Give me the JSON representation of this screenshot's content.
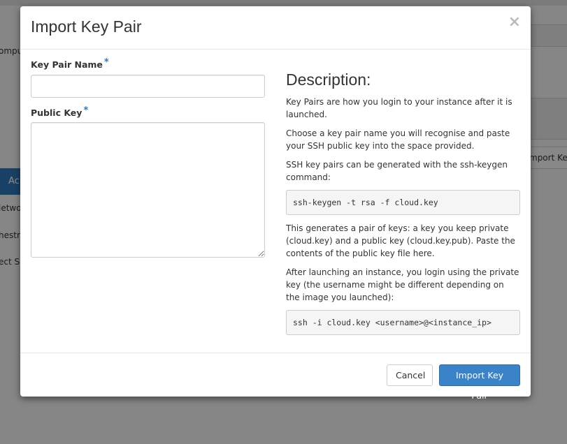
{
  "background": {
    "partial_texts": [
      "ompu",
      "Ac",
      "letwo",
      "hestr",
      "ect S",
      "mport Ke"
    ]
  },
  "modal": {
    "title": "Import Key Pair",
    "close_glyph": "×",
    "form": {
      "name_label": "Key Pair Name",
      "name_required": "*",
      "name_value": "",
      "public_key_label": "Public Key",
      "public_key_required": "*",
      "public_key_value": ""
    },
    "description": {
      "title": "Description:",
      "p1": "Key Pairs are how you login to your instance after it is launched.",
      "p2": "Choose a key pair name you will recognise and paste your SSH public key into the space provided.",
      "p3": "SSH key pairs can be generated with the ssh-keygen command:",
      "code1": "ssh-keygen -t rsa -f cloud.key",
      "p4": "This generates a pair of keys: a key you keep private (cloud.key) and a public key (cloud.key.pub). Paste the contents of the public key file here.",
      "p5": "After launching an instance, you login using the private key (the username might be different depending on the image you launched):",
      "code2": "ssh -i cloud.key <username>@<instance_ip>"
    },
    "footer": {
      "cancel_label": "Cancel",
      "submit_label": "Import Key Pair"
    }
  },
  "colors": {
    "primary": "#3a83c9",
    "required_marker": "#2e77bb"
  }
}
